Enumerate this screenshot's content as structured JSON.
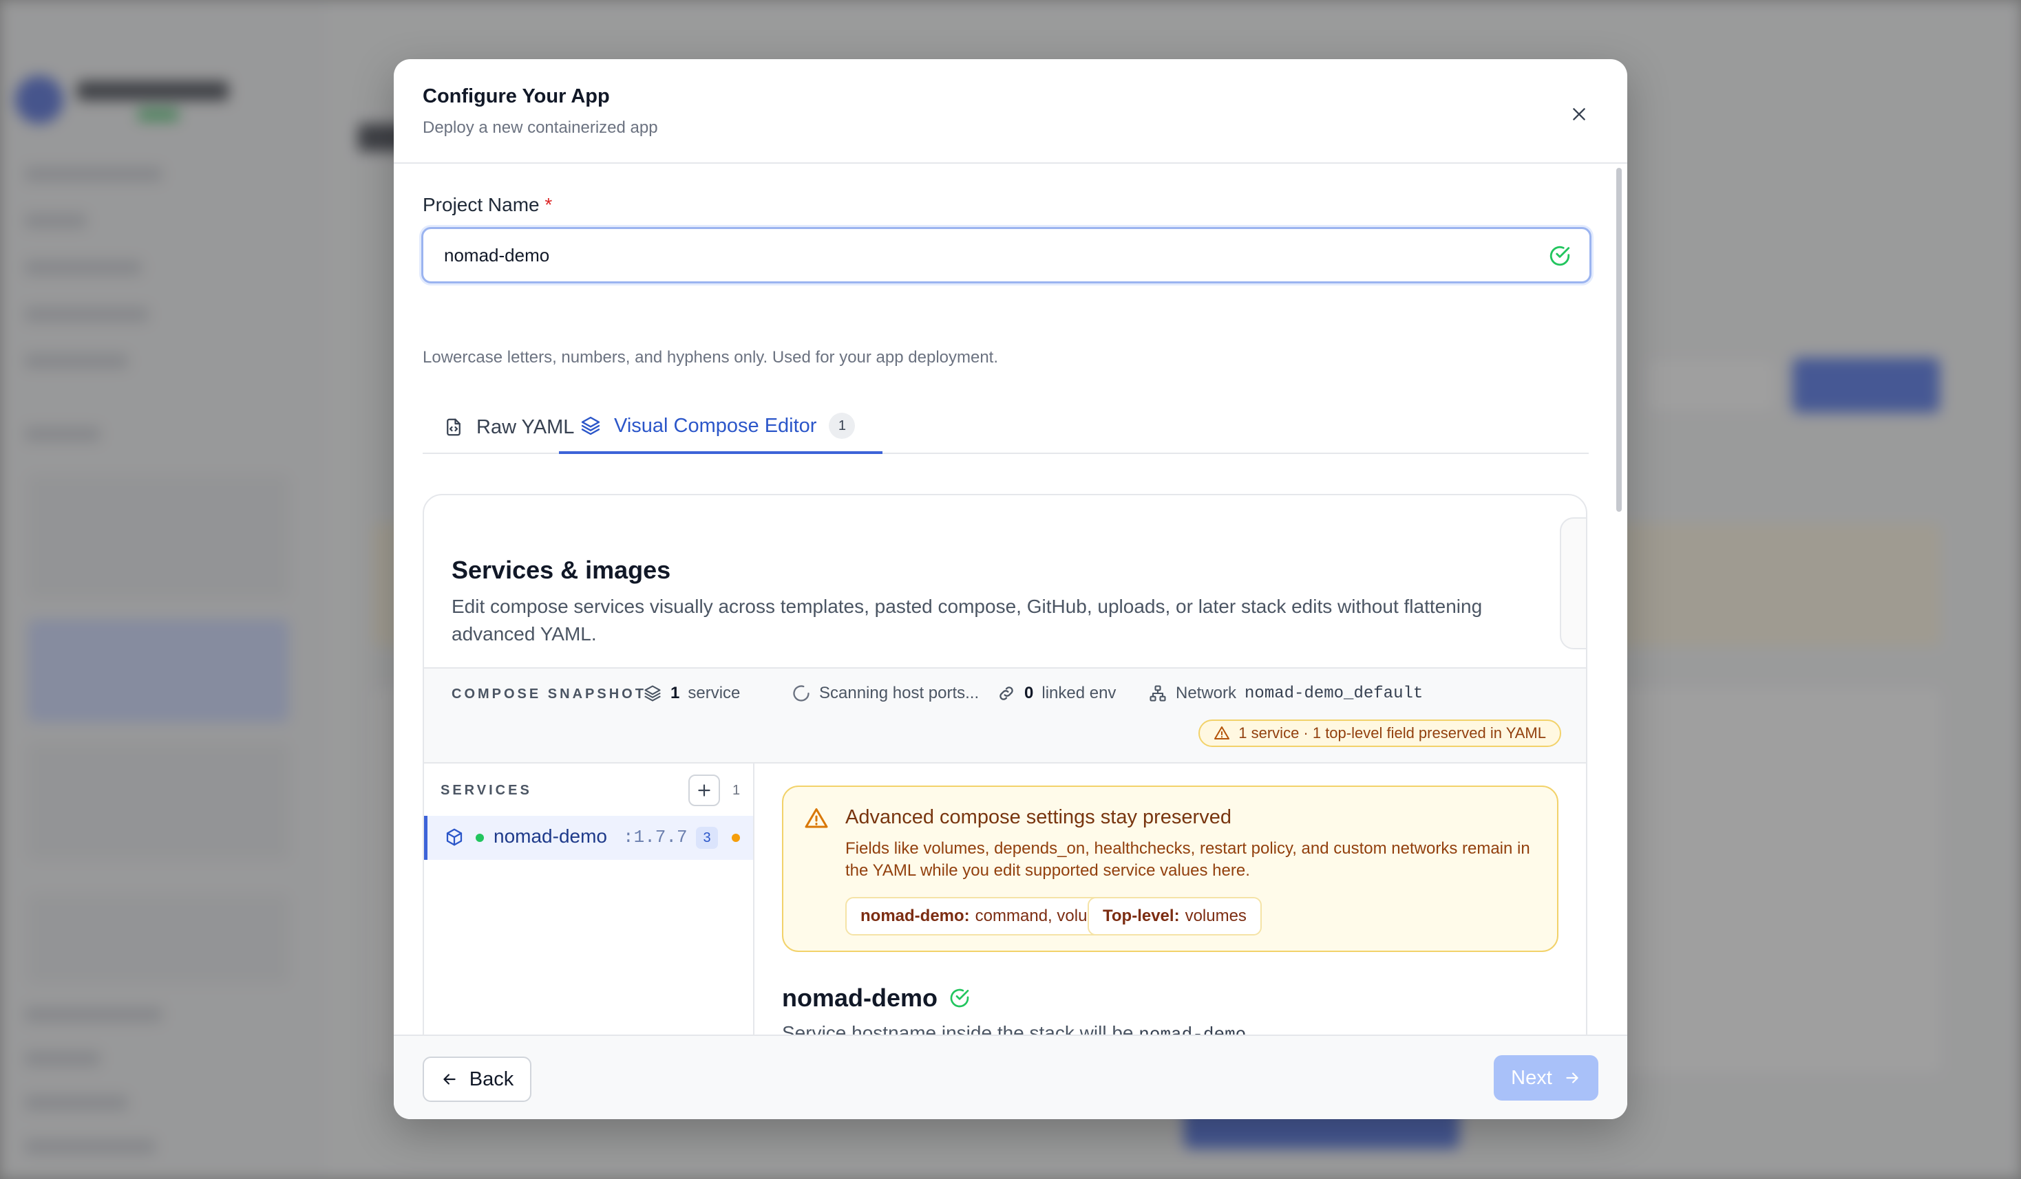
{
  "modal": {
    "title": "Configure Your App",
    "subtitle": "Deploy a new containerized app",
    "close_icon": "close-icon"
  },
  "project": {
    "label": "Project Name",
    "required_marker": "*",
    "value": "nomad-demo",
    "valid_icon": "check-circle-icon",
    "help": "Lowercase letters, numbers, and hyphens only. Used for your app deployment."
  },
  "tabs": [
    {
      "label": "Raw YAML",
      "icon": "file-code-icon",
      "active": false
    },
    {
      "label": "Visual Compose Editor",
      "icon": "layers-icon",
      "active": true,
      "count": "1"
    }
  ],
  "editor": {
    "title": "Services & images",
    "description": "Edit compose services visually across templates, pasted compose, GitHub, uploads, or later stack edits without flattening advanced YAML."
  },
  "snapshot": {
    "label": "COMPOSE SNAPSHOT",
    "services_count": "1",
    "services_label": "service",
    "scanning": "Scanning host ports...",
    "linked_env_count": "0",
    "linked_env_label": "linked env",
    "network_label": "Network",
    "network_name": "nomad-demo_default",
    "warning": "1 service · 1 top-level field preserved in YAML"
  },
  "services": {
    "header": "SERVICES",
    "count": "1",
    "items": [
      {
        "name": "nomad-demo",
        "version": ":1.7.7",
        "badge": "3"
      }
    ]
  },
  "callout": {
    "title": "Advanced compose settings stay preserved",
    "body": "Fields like volumes, depends_on, healthchecks, restart policy, and custom networks remain in the YAML while you edit supported service values here.",
    "chips": [
      {
        "key": "nomad-demo:",
        "value": "command, volumes"
      },
      {
        "key": "Top-level:",
        "value": "volumes"
      }
    ]
  },
  "service_detail": {
    "name": "nomad-demo",
    "desc_prefix": "Service hostname inside the stack will be ",
    "hostname": "nomad-demo",
    "desc_suffix": "."
  },
  "footer": {
    "back_label": "Back",
    "next_label": "Next"
  },
  "colors": {
    "accent": "#3d63d8",
    "warning_bg": "#fffbea",
    "warning_border": "#f2d26a",
    "success": "#22c55e",
    "next_disabled": "#a9c1f9"
  }
}
